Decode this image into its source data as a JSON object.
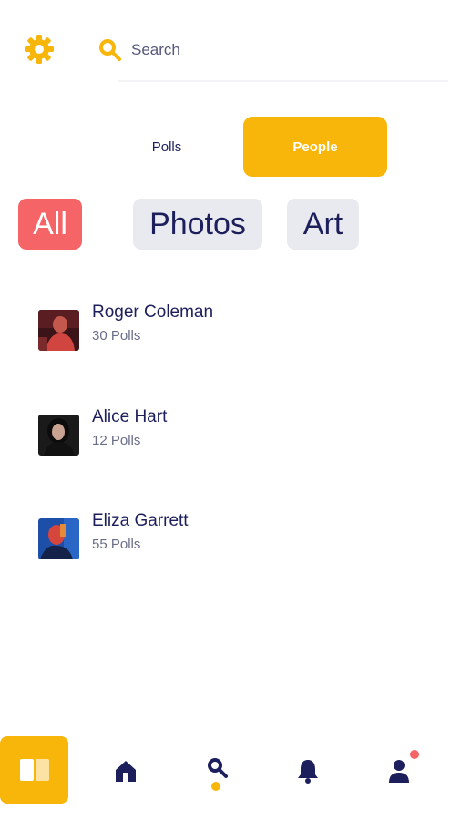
{
  "header": {
    "settings_icon": "gear-icon",
    "search": {
      "icon": "search-icon",
      "placeholder": "Search",
      "value": ""
    }
  },
  "segments": [
    {
      "label": "Polls",
      "selected": false
    },
    {
      "label": "People",
      "selected": true
    }
  ],
  "filters": [
    {
      "label": "All",
      "selected": true
    },
    {
      "label": "Photos",
      "selected": false
    },
    {
      "label": "Art",
      "selected": false
    }
  ],
  "people": [
    {
      "name": "Roger Coleman",
      "polls": "30 Polls"
    },
    {
      "name": "Alice Hart",
      "polls": "12 Polls"
    },
    {
      "name": "Eliza Garrett",
      "polls": "55 Polls"
    }
  ],
  "bottom_nav": {
    "items": [
      "book-icon",
      "home-icon",
      "search-icon",
      "bell-icon",
      "profile-icon"
    ],
    "active": "search-icon",
    "profile_has_notification": true
  },
  "colors": {
    "accent": "#f8b50a",
    "danger": "#f56567",
    "text": "#1d1f5c",
    "chip_bg": "#e9eaef"
  }
}
